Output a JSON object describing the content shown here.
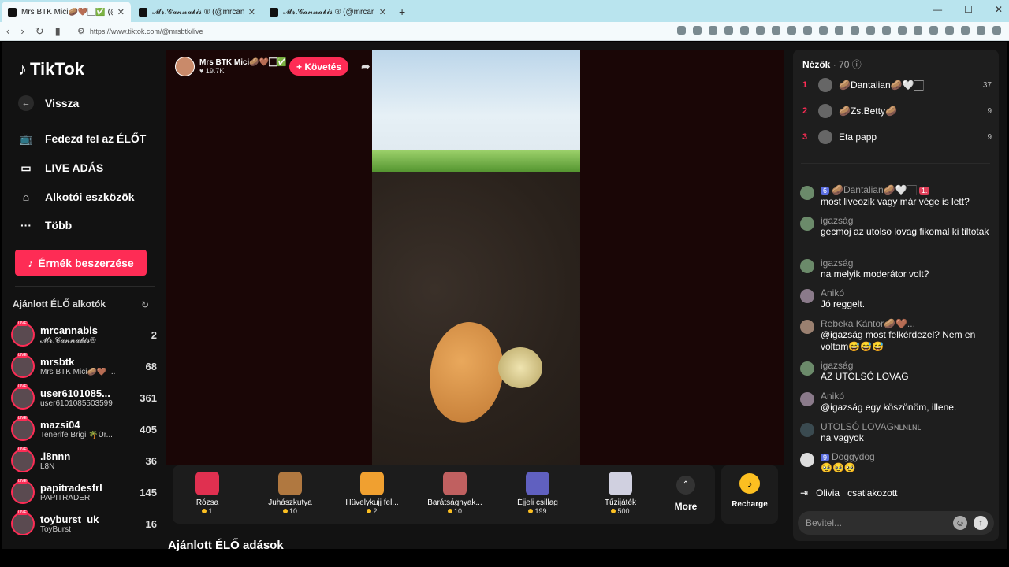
{
  "browser": {
    "tabs": [
      {
        "title": "Mrs BTK Mici🥔🤎🏻✅ (@m",
        "active": true
      },
      {
        "title": "𝓜𝓻.𝓒𝓪𝓷𝓷𝓪𝓫𝓲𝓼 ® (@mrcannabis_)",
        "active": false
      },
      {
        "title": "𝓜𝓻.𝓒𝓪𝓷𝓷𝓪𝓫𝓲𝓼 ® (@mrcannabis_)",
        "active": false
      }
    ],
    "new_tab": "+",
    "url": "https://www.tiktok.com/@mrsbtk/live"
  },
  "sidebar": {
    "logo": "TikTok",
    "back": "Vissza",
    "nav": [
      {
        "label": "Fedezd fel az ÉLŐT",
        "icon": "tv-icon"
      },
      {
        "label": "LIVE ADÁS",
        "icon": "camera-icon"
      },
      {
        "label": "Alkotói eszközök",
        "icon": "house-icon"
      },
      {
        "label": "Több",
        "icon": "more-icon"
      }
    ],
    "coins_button": "Érmék beszerzése",
    "recommended_title": "Ajánlott ÉLŐ alkotók",
    "creators": [
      {
        "name": "mrcannabis_",
        "sub": "𝓜𝓻.𝓒𝓪𝓷𝓷𝓪𝓫𝓲𝓼®",
        "count": "2"
      },
      {
        "name": "mrsbtk",
        "sub": "Mrs BTK Mici🥔🤎 ...",
        "count": "68"
      },
      {
        "name": "user6101085...",
        "sub": "user6101085503599",
        "count": "361"
      },
      {
        "name": "mazsi04",
        "sub": "Tenerife Brigi 🌴Úr...",
        "count": "405"
      },
      {
        "name": ".l8nnn",
        "sub": "L8N",
        "count": "36"
      },
      {
        "name": "papitradesfrl",
        "sub": "PAPITRADER",
        "count": "145"
      },
      {
        "name": "toyburst_uk",
        "sub": "ToyBurst",
        "count": "16"
      }
    ]
  },
  "stream": {
    "streamer_name": "Mrs BTK Mici🥔🤎🏻✅",
    "likes": "♥ 19.7K",
    "follow": "+ Követés",
    "gifts": [
      {
        "name": "Rózsa",
        "cost": "1",
        "color": "#e03050"
      },
      {
        "name": "Juhászkutya",
        "cost": "10",
        "color": "#b07840"
      },
      {
        "name": "Hüvelykujj fel...",
        "cost": "2",
        "color": "#f0a030"
      },
      {
        "name": "Barátságnyak...",
        "cost": "10",
        "color": "#c06060"
      },
      {
        "name": "Éjjeli csillag",
        "cost": "199",
        "color": "#6060c0"
      },
      {
        "name": "Tűzijáték",
        "cost": "500",
        "color": "#d0d0e0"
      }
    ],
    "more": "More",
    "recharge": "Recharge",
    "suggested_title": "Ajánlott ÉLŐ adások"
  },
  "chat": {
    "viewers_label": "Nézők",
    "viewers_count": "· 70",
    "top_viewers": [
      {
        "rank": "1",
        "name": "🥔Dantalian🥔🤍🏻",
        "score": "37"
      },
      {
        "rank": "2",
        "name": "🥔Zs.Betty🥔",
        "score": "9"
      },
      {
        "rank": "3",
        "name": "Eta papp",
        "score": "9"
      }
    ],
    "messages": [
      {
        "user": "🥔Dantalian🥔🤍🏻",
        "badge": "6",
        "badge2": "1.",
        "text": "most liveozik vagy már vége is lett?"
      },
      {
        "user": "igazság",
        "text": "gecmoj az utolso lovag fikomal ki tiltotak"
      },
      {
        "user": "igazság",
        "text": "na melyik moderátor volt?"
      },
      {
        "user": "Anikó",
        "text": "Jó reggelt."
      },
      {
        "user": "Rebeka Kántor🥔🤎...",
        "text": "@igazság most felkérdezel? Nem en voltam😅😅😅"
      },
      {
        "user": "igazság",
        "text": "AZ UTOLSÓ LOVAG"
      },
      {
        "user": "Anikó",
        "text": "@igazság egy köszönöm, illene."
      },
      {
        "user": "UTOLSÓ LOVAGɴʟɴʟɴʟ",
        "text": "na vagyok"
      },
      {
        "user": "Doggydog",
        "badge": "9",
        "text": "🥹🥹🥹"
      }
    ],
    "joined_user": "Olivia",
    "joined_text": "csatlakozott",
    "input_placeholder": "Bevitel..."
  }
}
